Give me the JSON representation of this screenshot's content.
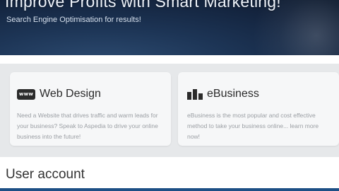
{
  "hero": {
    "title": "Improve Profits with Smart Marketing!",
    "subtitle": "Search Engine Optimisation for results!"
  },
  "cards": [
    {
      "icon": "www-icon",
      "icon_text": "www",
      "title": "Web Design",
      "text": "Need a Website that drives traffic and warm leads for your business? Speak to Aspedia to drive your online business into the future!"
    },
    {
      "icon": "bar-chart-icon",
      "title": "eBusiness",
      "text": "eBusiness is the most popular and cost effective method to take your business online... learn more now!"
    }
  ],
  "section": {
    "title": "User account"
  },
  "colors": {
    "hero_dark": "#13233d",
    "hero_mid": "#2e4d73",
    "bottom_stripe": "#1d4f85"
  }
}
